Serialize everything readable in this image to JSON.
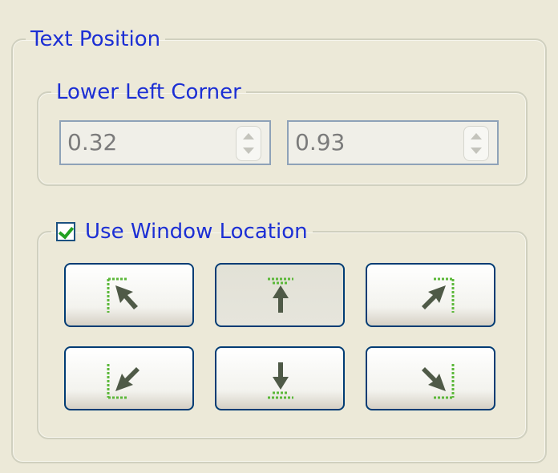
{
  "text_position": {
    "title": "Text Position",
    "lower_left_corner": {
      "title": "Lower Left Corner",
      "x_value": "0.32",
      "y_value": "0.93"
    },
    "use_window_location": {
      "label": "Use Window Location",
      "checked": true,
      "buttons": [
        {
          "name": "upper-left",
          "icon": "upper-left-position-icon"
        },
        {
          "name": "upper-center",
          "icon": "upper-center-position-icon",
          "pressed": true
        },
        {
          "name": "upper-right",
          "icon": "upper-right-position-icon"
        },
        {
          "name": "lower-left",
          "icon": "lower-left-position-icon"
        },
        {
          "name": "lower-center",
          "icon": "lower-center-position-icon"
        },
        {
          "name": "lower-right",
          "icon": "lower-right-position-icon"
        }
      ]
    }
  },
  "colors": {
    "legend_text": "#1c2fd4",
    "window_bg": "#ece9d8",
    "dot_green": "#5cb83a",
    "arrow_dark": "#4f5a47",
    "checkmark": "#21a121"
  }
}
